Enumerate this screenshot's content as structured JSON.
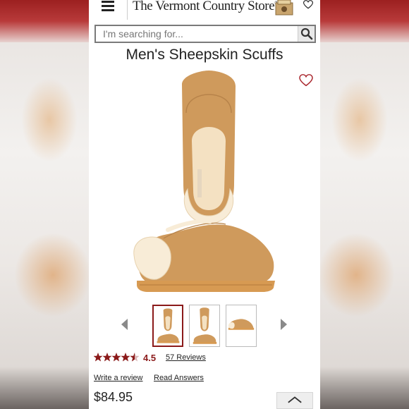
{
  "header": {
    "logo_text": "The Vermont Country Store",
    "logo_mark": "®",
    "icons": [
      "menu-icon",
      "catalog-icon",
      "heart-icon"
    ]
  },
  "search": {
    "placeholder": "I'm searching for...",
    "icon": "search-icon"
  },
  "product": {
    "title": "Men's Sheepskin Scuffs",
    "wishlist_icon": "heart-outline-icon",
    "rating": {
      "stars": 4.5,
      "value_text": "4.5",
      "reviews_text": "57 Reviews"
    },
    "write_review": "Write a review",
    "read_answers": "Read Answers",
    "price": "$84.95"
  },
  "gallery": {
    "thumbnails": [
      "slippers-pair-view",
      "slippers-pair-view-alt",
      "slippers-side-view"
    ],
    "active_index": 0,
    "prev_icon": "chevron-left-icon",
    "next_icon": "chevron-right-icon"
  },
  "scroll_top_icon": "chevron-up-icon",
  "colors": {
    "brand_red": "#8b1a1a",
    "suede": "#cf9a5c",
    "fleece": "#f6e8cf",
    "sole": "#d79a52"
  }
}
